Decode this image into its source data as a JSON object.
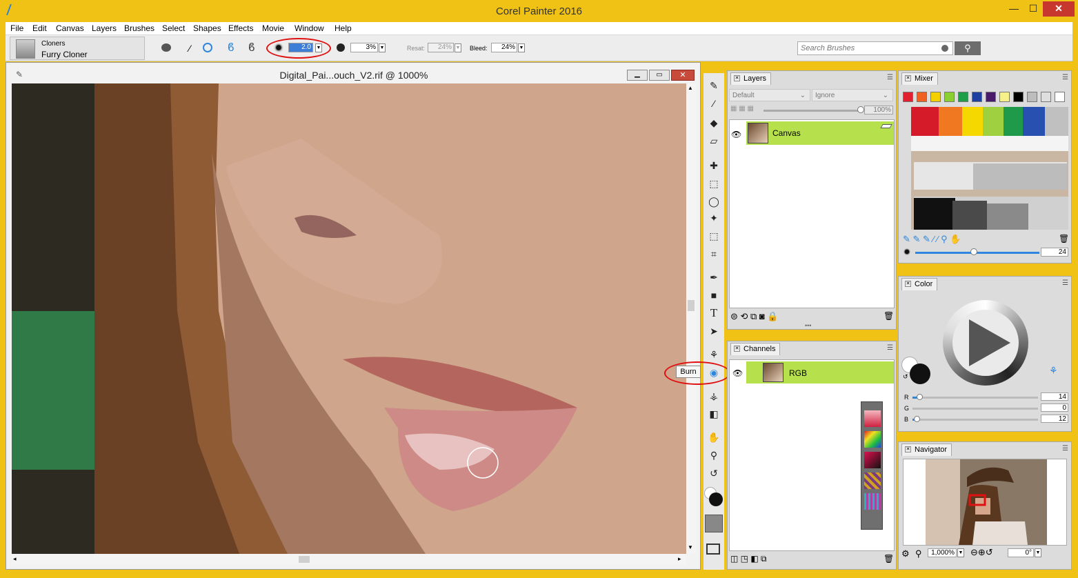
{
  "app": {
    "title": "Corel Painter 2016",
    "minimize": "—",
    "maximize": "☐",
    "close": "✕"
  },
  "menu": [
    "File",
    "Edit",
    "Canvas",
    "Layers",
    "Brushes",
    "Select",
    "Shapes",
    "Effects",
    "Movie",
    "Window",
    "Help"
  ],
  "brush": {
    "category": "Cloners",
    "variant": "Furry Cloner"
  },
  "property_bar": {
    "size_value": "2.0",
    "opacity_value": "3%",
    "resat_label": "Resat:",
    "resat_value": "24%",
    "bleed_label": "Bleed:",
    "bleed_value": "24%"
  },
  "search": {
    "placeholder": "Search Brushes"
  },
  "document": {
    "title": "Digital_Pai...ouch_V2.rif @ 1000%"
  },
  "tooltip": {
    "text": "Burn"
  },
  "layers_panel": {
    "tab": "Layers",
    "composite_method": "Default",
    "preserve": "Ignore",
    "opacity_value": "100%",
    "layer_name": "Canvas"
  },
  "channels_panel": {
    "tab": "Channels",
    "channel_name": "RGB"
  },
  "mixer_panel": {
    "tab": "Mixer",
    "brush_size": "24",
    "swatch_colors": [
      "#e0202e",
      "#f06020",
      "#f5d000",
      "#8ccf30",
      "#1e9e48",
      "#1c3fa0",
      "#4a1a6a",
      "#f5f08a",
      "#000000",
      "#bdbdbd",
      "#dedede",
      "#ffffff"
    ]
  },
  "color_panel": {
    "tab": "Color",
    "r_label": "R",
    "r_value": "14",
    "g_label": "G",
    "g_value": "0",
    "b_label": "B",
    "b_value": "12"
  },
  "navigator_panel": {
    "tab": "Navigator",
    "zoom_value": "1,000%",
    "rotation_value": "0°"
  }
}
